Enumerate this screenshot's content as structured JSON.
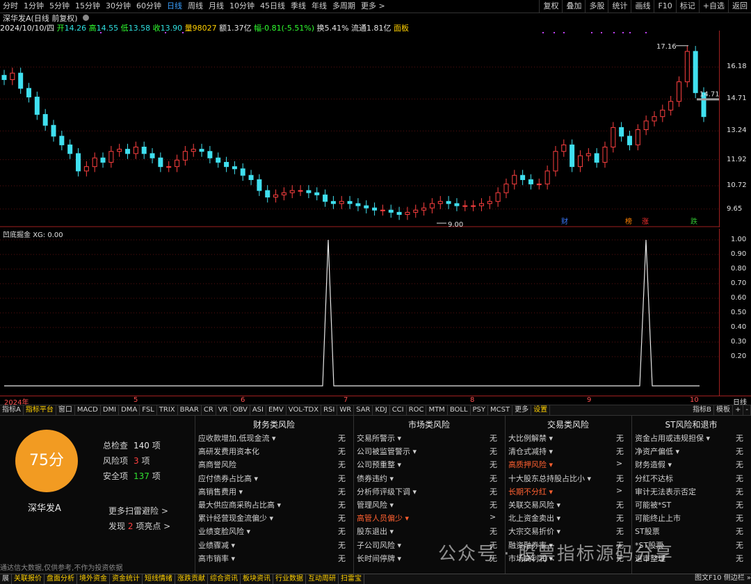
{
  "periods": [
    "分时",
    "1分钟",
    "5分钟",
    "15分钟",
    "30分钟",
    "60分钟",
    "日线",
    "周线",
    "月线",
    "10分钟",
    "45日线",
    "季线",
    "年线",
    "多周期",
    "更多 >"
  ],
  "active_period": "日线",
  "right_buttons": [
    "复权",
    "叠加",
    "多股",
    "统计",
    "画线",
    "F10",
    "标记",
    "+自选",
    "返回"
  ],
  "title": "深华发A(日线 前复权)",
  "info": {
    "date": "2024/10/10/四",
    "open_l": "开",
    "open": "14.26",
    "high_l": "高",
    "high": "14.55",
    "low_l": "低",
    "low": "13.58",
    "close_l": "收",
    "close": "13.90",
    "vol_l": "量",
    "vol": "98027",
    "amt_l": "额",
    "amt": "1.37亿",
    "chg_l": "幅",
    "chg": "-0.81(-5.51%)",
    "turn_l": "换",
    "turn": "5.41%",
    "float_l": "流通",
    "float": "1.81亿",
    "board": "面板"
  },
  "price_axis": [
    "16.18",
    "14.71",
    "13.24",
    "11.92",
    "10.72",
    "9.65"
  ],
  "max_label": "17.16",
  "min_label": "9.00",
  "last_label": "14.71",
  "chart_markers": [
    {
      "text": "财",
      "color": "#3a7bff"
    },
    {
      "text": "榜",
      "color": "#ff8000"
    },
    {
      "text": "涨",
      "color": "#ff3030"
    },
    {
      "text": "跌",
      "color": "#30c030"
    }
  ],
  "indicator": {
    "name": "凹底掘金",
    "xg": "XG: 0.00"
  },
  "ind_axis": [
    "1.00",
    "0.90",
    "0.80",
    "0.70",
    "0.60",
    "0.50",
    "0.40",
    "0.30",
    "0.20"
  ],
  "dates": [
    "2024年",
    "5",
    "6",
    "7",
    "8",
    "9",
    "10"
  ],
  "tabs_label_right": "日线",
  "tabs": [
    "指标A",
    "指标平台",
    "窗口",
    "MACD",
    "DMI",
    "DMA",
    "FSL",
    "TRIX",
    "BRAR",
    "CR",
    "VR",
    "OBV",
    "ASI",
    "EMV",
    "VOL-TDX",
    "RSI",
    "WR",
    "SAR",
    "KDJ",
    "CCI",
    "ROC",
    "MTM",
    "BOLL",
    "PSY",
    "MCST",
    "更多",
    "设置"
  ],
  "tabs_right": [
    "指标B",
    "模板",
    "+",
    "-"
  ],
  "panel": {
    "score": "75分",
    "stock": "深华发A",
    "total_l": "总检查",
    "total": "140",
    "total_u": "项",
    "risk_l": "风险项",
    "risk": "3",
    "risk_u": "项",
    "safe_l": "安全项",
    "safe": "137",
    "safe_u": "项",
    "more": "更多扫雷避险 >",
    "found_pre": "发现",
    "found": "2",
    "found_post": "项亮点 >",
    "disclaimer": "通达信大数据,仅供参考,不作为投资依据",
    "watermark": "公众号 · 股票指标源码分享",
    "columns": [
      {
        "title": "财务类风险",
        "rows": [
          [
            "应收款增加,低现金流 ▾",
            "无"
          ],
          [
            "高研发费用资本化",
            "无"
          ],
          [
            "高商誉风险",
            "无"
          ],
          [
            "应付债券占比高 ▾",
            "无"
          ],
          [
            "高销售费用 ▾",
            "无"
          ],
          [
            "最大供应商采购占比高 ▾",
            "无"
          ],
          [
            "累计经营现金流偏少 ▾",
            "无"
          ],
          [
            "业绩变脸风险 ▾",
            "无"
          ],
          [
            "业绩骤减 ▾",
            "无"
          ],
          [
            "高市销率 ▾",
            "无"
          ]
        ]
      },
      {
        "title": "市场类风险",
        "rows": [
          [
            "交易所警示 ▾",
            "无"
          ],
          [
            "公司被监管警示 ▾",
            "无"
          ],
          [
            "公司预重整 ▾",
            "无"
          ],
          [
            "债券违约 ▾",
            "无"
          ],
          [
            "分析师评级下调 ▾",
            "无"
          ],
          [
            "管理风险 ▾",
            "无"
          ],
          [
            "高管人员偏少 ▾",
            ">"
          ],
          [
            "股东退出 ▾",
            "无"
          ],
          [
            "子公司风险 ▾",
            "无"
          ],
          [
            "长时间停牌 ▾",
            "无"
          ]
        ]
      },
      {
        "title": "交易类风险",
        "rows": [
          [
            "大比例解禁 ▾",
            "无"
          ],
          [
            "清仓式减持 ▾",
            "无"
          ],
          [
            "高质押风险 ▾",
            ">"
          ],
          [
            "十大股东总持股占比小 ▾",
            "无"
          ],
          [
            "长期不分红 ▾",
            ">"
          ],
          [
            "关联交易风险 ▾",
            "无"
          ],
          [
            "北上资金卖出 ▾",
            "无"
          ],
          [
            "大宗交易折价 ▾",
            "无"
          ],
          [
            "融资融券率 ▾",
            "无"
          ],
          [
            "市场高利润 ▾",
            "无"
          ]
        ]
      },
      {
        "title": "ST风险和退市",
        "rows": [
          [
            "资金占用或违规担保 ▾",
            "无"
          ],
          [
            "净资产偏低 ▾",
            "无"
          ],
          [
            "财务造假 ▾",
            "无"
          ],
          [
            "分红不达标",
            "无"
          ],
          [
            "审计无法表示否定",
            "无"
          ],
          [
            "可能被*ST",
            "无"
          ],
          [
            "可能终止上市",
            "无"
          ],
          [
            "ST股票",
            "无"
          ],
          [
            "*ST股票",
            "无"
          ],
          [
            "退市整理",
            "无"
          ]
        ]
      }
    ]
  },
  "statusbar": [
    "展",
    "关联报价",
    "盘面分析",
    "境外资金",
    "资金统计",
    "短线情绪",
    "涨跌贡献",
    "综合资讯",
    "板块资讯",
    "行业数据",
    "互动周研",
    "扫雷宝"
  ],
  "status_right": "图文F10  侧边栏 »",
  "chart_data": {
    "type": "candlestick",
    "title": "深华发A(日线 前复权)",
    "y_axis_ticks": [
      16.18,
      14.71,
      13.24,
      11.92,
      10.72,
      9.65
    ],
    "ylim": [
      9.0,
      17.16
    ],
    "annotations": {
      "high": 17.16,
      "low": 9.0,
      "last": 14.71
    },
    "x_ticks": [
      "2024年",
      "5",
      "6",
      "7",
      "8",
      "9",
      "10"
    ],
    "indicator": {
      "name": "凹底掘金",
      "ylim": [
        0,
        1
      ],
      "spikes": [
        {
          "x_month": "7-",
          "value": 1.0
        },
        {
          "x_month": "9-10",
          "value": 1.0
        }
      ]
    }
  }
}
